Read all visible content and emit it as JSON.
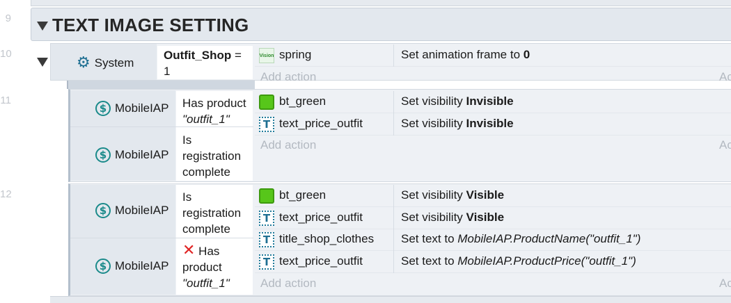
{
  "line_numbers": [
    "9",
    "10",
    "11",
    "12"
  ],
  "group": {
    "title": "TEXT IMAGE SETTING"
  },
  "event10": {
    "condition": {
      "object": "System",
      "var_name": "Outfit_Shop",
      "var_op": " = ",
      "var_value": "1"
    },
    "actions": [
      {
        "object": "spring",
        "icon": "sprite-icon",
        "icon_label": "Vision",
        "action_text": "Set animation frame to ",
        "action_bold": "0"
      }
    ],
    "add_action": "Add action",
    "add_right": "Ac"
  },
  "event11": {
    "conditions": [
      {
        "object": "MobileIAP",
        "line1": "Has product",
        "line2": "\"outfit_1\""
      },
      {
        "object": "MobileIAP",
        "line1": "Is",
        "line2": "registration",
        "line3": "complete"
      }
    ],
    "actions": [
      {
        "object": "bt_green",
        "icon": "green-sprite-icon",
        "action_text": "Set visibility ",
        "action_bold": "Invisible"
      },
      {
        "object": "text_price_outfit",
        "icon": "text-object-icon",
        "icon_label": "T",
        "action_text": "Set visibility ",
        "action_bold": "Invisible"
      }
    ],
    "add_action": "Add action",
    "add_right": "Ac"
  },
  "event12": {
    "conditions": [
      {
        "object": "MobileIAP",
        "line1": "Is",
        "line2": "registration",
        "line3": "complete"
      },
      {
        "object": "MobileIAP",
        "invert_icon": "✕",
        "line1": "Has",
        "line2": "product",
        "line3": "\"outfit_1\""
      }
    ],
    "actions": [
      {
        "object": "bt_green",
        "icon": "green-sprite-icon",
        "action_text": "Set visibility ",
        "action_bold": "Visible"
      },
      {
        "object": "text_price_outfit",
        "icon": "text-object-icon",
        "icon_label": "T",
        "action_text": "Set visibility ",
        "action_bold": "Visible"
      },
      {
        "object": "title_shop_clothes",
        "icon": "text-object-icon",
        "icon_label": "T",
        "action_text": "Set text to ",
        "action_italic": "MobileIAP.ProductName(\"outfit_1\")"
      },
      {
        "object": "text_price_outfit",
        "icon": "text-object-icon",
        "icon_label": "T",
        "action_text": "Set text to ",
        "action_italic": "MobileIAP.ProductPrice(\"outfit_1\")"
      }
    ],
    "add_action": "Add action",
    "add_right": "Ac"
  },
  "colors": {
    "group_header_bg": "#e3e8ee",
    "condition_bg": "#e3e8ee",
    "event_bg": "#eef1f5",
    "accent_teal": "#1a8a8a",
    "placeholder_gray": "#b3b9c1",
    "invert_red": "#e02424",
    "sprite_green": "#57c61a"
  }
}
